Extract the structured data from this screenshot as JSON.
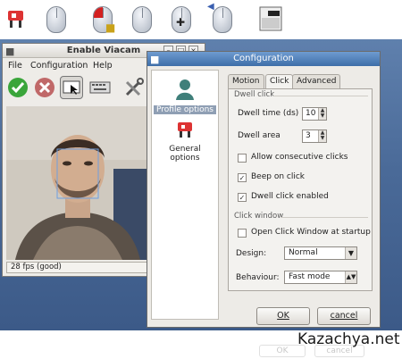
{
  "toolbar_icons": [
    "viacam-logo-icon",
    "mouse-icon",
    "mouse-lock-icon",
    "mouse-click-icon",
    "mouse-move-icon",
    "mouse-drag-icon",
    "mouse-wheel-icon",
    "click-window-icon"
  ],
  "viacam_window": {
    "title": "Enable Viacam",
    "menu": [
      "File",
      "Configuration",
      "Help"
    ],
    "tools": [
      "enable-check-icon",
      "disable-cancel-icon",
      "click-window-toggle-icon",
      "keyboard-icon",
      "tools-icon"
    ],
    "status": "28 fps (good)"
  },
  "config_window": {
    "title": "Configuration",
    "sidebar": [
      "Profile options",
      "General options"
    ],
    "tabs": [
      "Motion",
      "Click",
      "Advanced"
    ],
    "dwell_group": "Dwell click",
    "dwell_time_label": "Dwell time (ds)",
    "dwell_time_value": "10",
    "dwell_area_label": "Dwell area",
    "dwell_area_value": "3",
    "allow_consecutive": "Allow consecutive clicks",
    "beep": "Beep on click",
    "dwell_enabled": "Dwell click enabled",
    "click_window_group": "Click window",
    "open_click_window": "Open Click Window at startup",
    "design_label": "Design:",
    "design_value": "Normal",
    "behaviour_label": "Behaviour:",
    "behaviour_value": "Fast mode",
    "ok": "OK",
    "cancel": "cancel"
  },
  "reflection": {
    "ok": "OK",
    "cancel": "cancel"
  },
  "watermark": "Kazachya.net"
}
